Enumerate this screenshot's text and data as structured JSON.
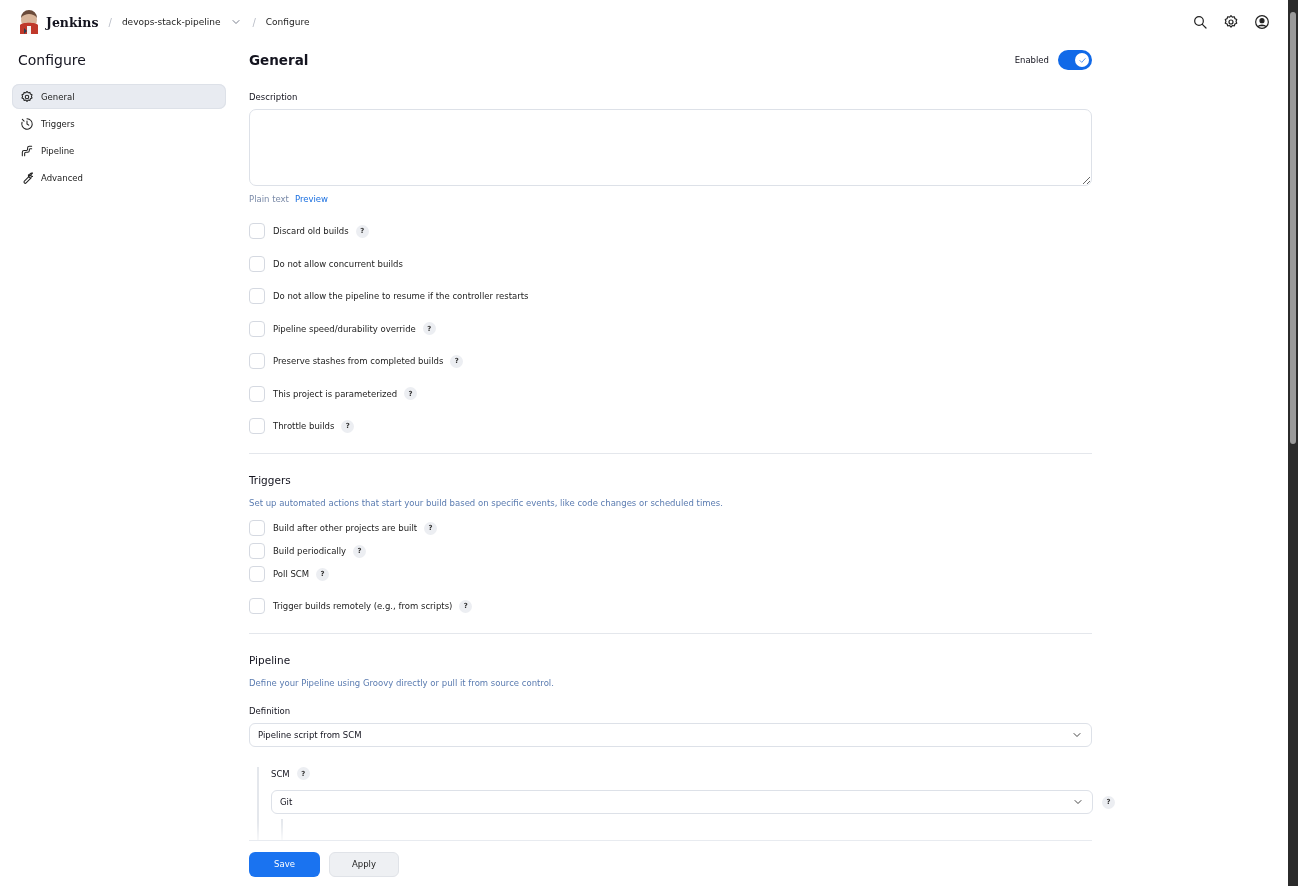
{
  "header": {
    "brand": "Jenkins",
    "breadcrumbs": [
      {
        "separator": "/",
        "label": "devops-stack-pipeline",
        "dropdown": true
      },
      {
        "separator": "/",
        "label": "Configure",
        "dropdown": false
      }
    ]
  },
  "sidebar": {
    "title": "Configure",
    "items": [
      {
        "label": "General",
        "selected": true
      },
      {
        "label": "Triggers",
        "selected": false
      },
      {
        "label": "Pipeline",
        "selected": false
      },
      {
        "label": "Advanced",
        "selected": false
      }
    ]
  },
  "general": {
    "title": "General",
    "enabled_label": "Enabled",
    "enabled": true,
    "description_label": "Description",
    "format_links": [
      {
        "label": "Plain text",
        "selected": true
      },
      {
        "label": "Preview",
        "selected": false
      }
    ],
    "options": [
      {
        "label": "Discard old builds",
        "checked": false,
        "help": "?"
      },
      {
        "label": "Do not allow concurrent builds",
        "checked": false
      },
      {
        "label": "Do not allow the pipeline to resume if the controller restarts",
        "checked": false
      },
      {
        "label": "Pipeline speed/durability override",
        "checked": false,
        "help": "?"
      },
      {
        "label": "Preserve stashes from completed builds",
        "checked": false,
        "help": "?"
      },
      {
        "label": "This project is parameterized",
        "checked": false,
        "help": "?"
      },
      {
        "label": "Throttle builds",
        "checked": false,
        "help": "?"
      }
    ]
  },
  "triggers": {
    "title": "Triggers",
    "description": "Set up automated actions that start your build based on specific events, like code changes or scheduled times.",
    "options": [
      {
        "label": "Build after other projects are built",
        "checked": false,
        "help": "?"
      },
      {
        "label": "Build periodically",
        "checked": false,
        "help": "?"
      },
      {
        "label": "Poll SCM",
        "checked": false,
        "help": "?"
      },
      {
        "label": "Trigger builds remotely (e.g., from scripts)",
        "checked": false,
        "help": "?"
      }
    ]
  },
  "pipeline": {
    "title": "Pipeline",
    "description": "Define your Pipeline using Groovy directly or pull it from source control.",
    "definition_label": "Definition",
    "definition_value": "Pipeline script from SCM",
    "scm_label": "SCM",
    "scm_help": "?",
    "scm_value": "Git",
    "scm_side_help": "?"
  },
  "footer": {
    "buttons": [
      {
        "label": "Save",
        "kind": "primary"
      },
      {
        "label": "Apply",
        "kind": "secondary"
      }
    ]
  }
}
